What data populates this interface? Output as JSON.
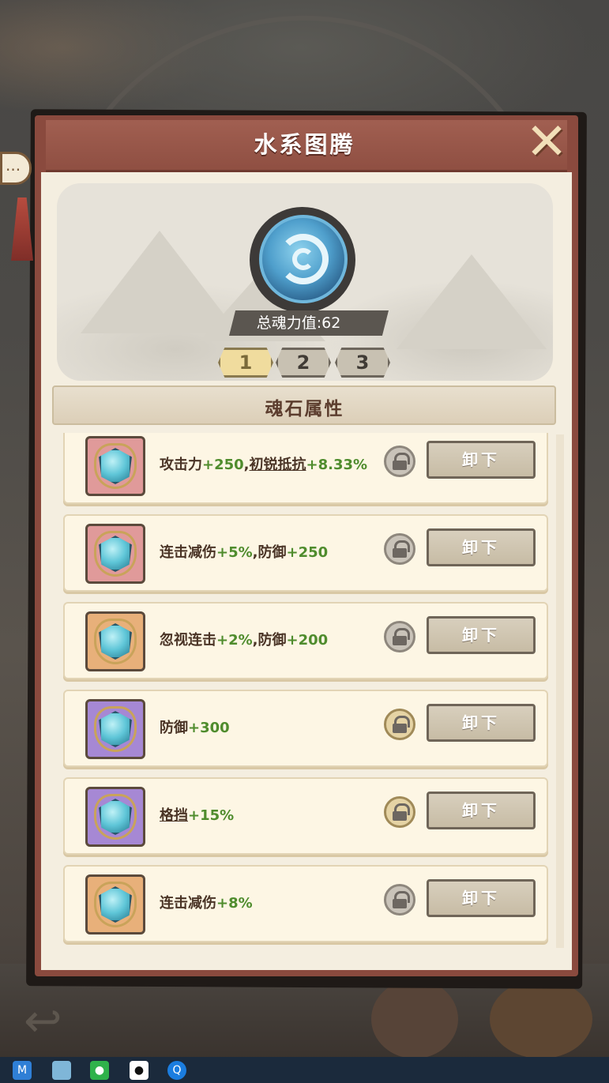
{
  "header": {
    "title": "水系图腾",
    "close_label": "✕"
  },
  "totem": {
    "power_label": "总魂力值:62"
  },
  "pages": [
    "1",
    "2",
    "3"
  ],
  "active_page": 0,
  "section": {
    "title": "魂石属性"
  },
  "rows": [
    {
      "stone_color": "#e09a9a",
      "parts": [
        {
          "t": "攻击力",
          "c": "n"
        },
        {
          "t": "+250",
          "c": "g"
        },
        {
          "t": ",",
          "c": "n"
        },
        {
          "t": "初锐抵抗",
          "c": "u"
        },
        {
          "t": "+8.33%",
          "c": "g"
        }
      ],
      "lock": "gray",
      "button": "卸下"
    },
    {
      "stone_color": "#e09a9a",
      "parts": [
        {
          "t": "连击减伤",
          "c": "n"
        },
        {
          "t": "+5%",
          "c": "g"
        },
        {
          "t": ",防御",
          "c": "n"
        },
        {
          "t": "+250",
          "c": "g"
        }
      ],
      "lock": "gray",
      "button": "卸下"
    },
    {
      "stone_color": "#e8b07a",
      "parts": [
        {
          "t": "忽视连击",
          "c": "n"
        },
        {
          "t": "+2%",
          "c": "g"
        },
        {
          "t": ",防御",
          "c": "n"
        },
        {
          "t": "+200",
          "c": "g"
        }
      ],
      "lock": "gray",
      "button": "卸下"
    },
    {
      "stone_color": "#a688d4",
      "parts": [
        {
          "t": "防御",
          "c": "n"
        },
        {
          "t": "+300",
          "c": "g"
        }
      ],
      "lock": "gold",
      "button": "卸下"
    },
    {
      "stone_color": "#a688d4",
      "parts": [
        {
          "t": "格挡",
          "c": "u"
        },
        {
          "t": "+15%",
          "c": "g"
        }
      ],
      "lock": "gold",
      "button": "卸下"
    },
    {
      "stone_color": "#e8b07a",
      "parts": [
        {
          "t": "连击减伤",
          "c": "n"
        },
        {
          "t": "+8%",
          "c": "g"
        }
      ],
      "lock": "gray",
      "button": "卸下"
    }
  ],
  "colors": {
    "panel": "#8a4a3e",
    "attr_positive": "#4f8c2d",
    "panel_bg": "#f4eee0"
  },
  "taskbar_icons": [
    "app-m-icon",
    "tablet-icon",
    "wechat-icon",
    "qq-icon",
    "browser-icon"
  ]
}
